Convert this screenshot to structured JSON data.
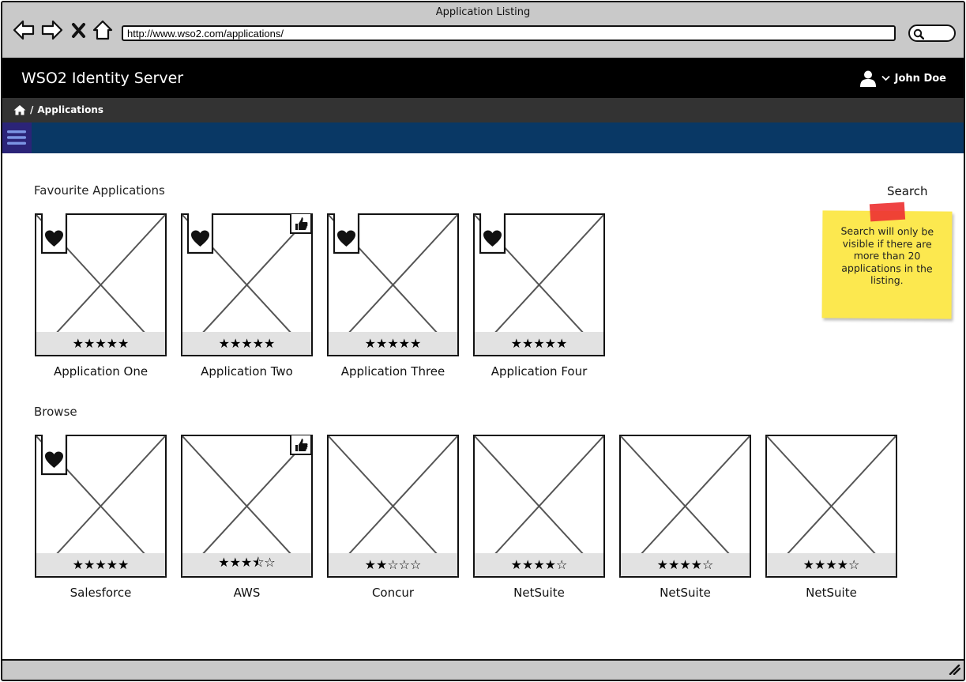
{
  "window": {
    "title": "Application Listing",
    "url": "http://www.wso2.com/applications/"
  },
  "header": {
    "brand": "WSO2 Identity Server",
    "user": "John Doe"
  },
  "breadcrumb": {
    "separator": "/",
    "current": "Applications"
  },
  "favourites": {
    "title": "Favourite Applications",
    "apps": [
      {
        "name": "Application One",
        "rating": "★★★★★",
        "favourite": true,
        "liked": false
      },
      {
        "name": "Application Two",
        "rating": "★★★★★",
        "favourite": true,
        "liked": true
      },
      {
        "name": "Application Three",
        "rating": "★★★★★",
        "favourite": true,
        "liked": false
      },
      {
        "name": "Application Four",
        "rating": "★★★★★",
        "favourite": true,
        "liked": false
      }
    ]
  },
  "browse": {
    "title": "Browse",
    "apps": [
      {
        "name": "Salesforce",
        "rating": "★★★★★",
        "favourite": true,
        "liked": false
      },
      {
        "name": "AWS",
        "rating": "★★★⯪☆",
        "favourite": false,
        "liked": true
      },
      {
        "name": "Concur",
        "rating": "★★☆☆☆",
        "favourite": false,
        "liked": false
      },
      {
        "name": "NetSuite",
        "rating": "★★★★☆",
        "favourite": false,
        "liked": false
      },
      {
        "name": "NetSuite",
        "rating": "★★★★☆",
        "favourite": false,
        "liked": false
      },
      {
        "name": "NetSuite",
        "rating": "★★★★☆",
        "favourite": false,
        "liked": false
      }
    ]
  },
  "search": {
    "label": "Search",
    "note": "Search will only be visible if there are more than 20 applications in the listing."
  },
  "icons": [
    "back-icon",
    "forward-icon",
    "stop-icon",
    "home-icon",
    "user-icon",
    "chevron-down-icon",
    "hamburger-icon",
    "heart-icon",
    "thumbs-up-icon",
    "resize-grip-icon"
  ],
  "colors": {
    "header": "#000000",
    "breadcrumb_bar": "#333333",
    "nav_bar": "#093865",
    "menu_button": "#2b2478",
    "sticky_note": "#fce84f"
  }
}
